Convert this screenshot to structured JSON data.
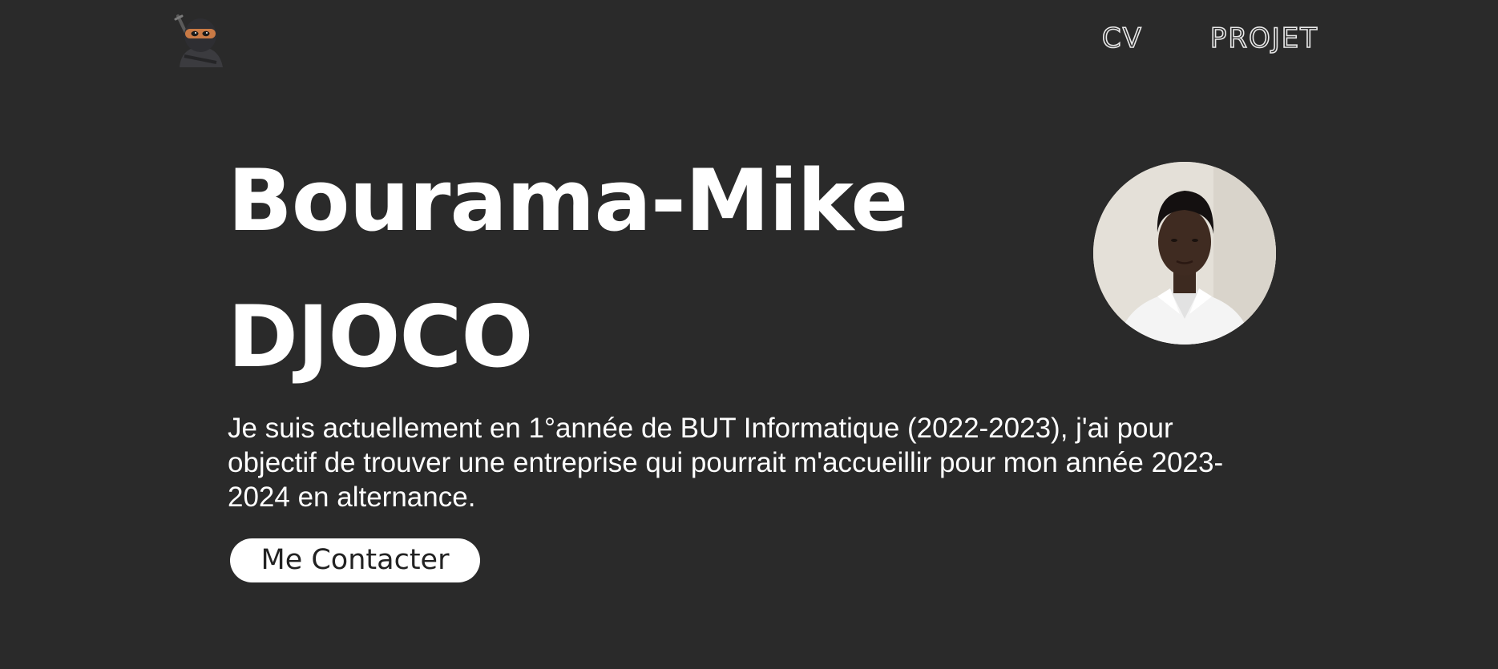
{
  "header": {
    "logo_icon": "ninja-emoji-icon",
    "nav": [
      {
        "label": "CV"
      },
      {
        "label": "PROJET"
      }
    ]
  },
  "hero": {
    "name_line1": "Bourama-Mike",
    "name_line2": "DJOCO",
    "photo_icon": "profile-photo",
    "intro": "Je suis actuellement en 1°année de BUT Informatique (2022-2023), j'ai pour objectif de trouver une entreprise qui pourrait m'accueillir pour mon année 2023-2024 en alternance.",
    "contact_label": "Me Contacter"
  },
  "colors": {
    "background": "#2a2a2a",
    "text": "#ffffff",
    "button_bg": "#ffffff",
    "button_text": "#222222"
  }
}
